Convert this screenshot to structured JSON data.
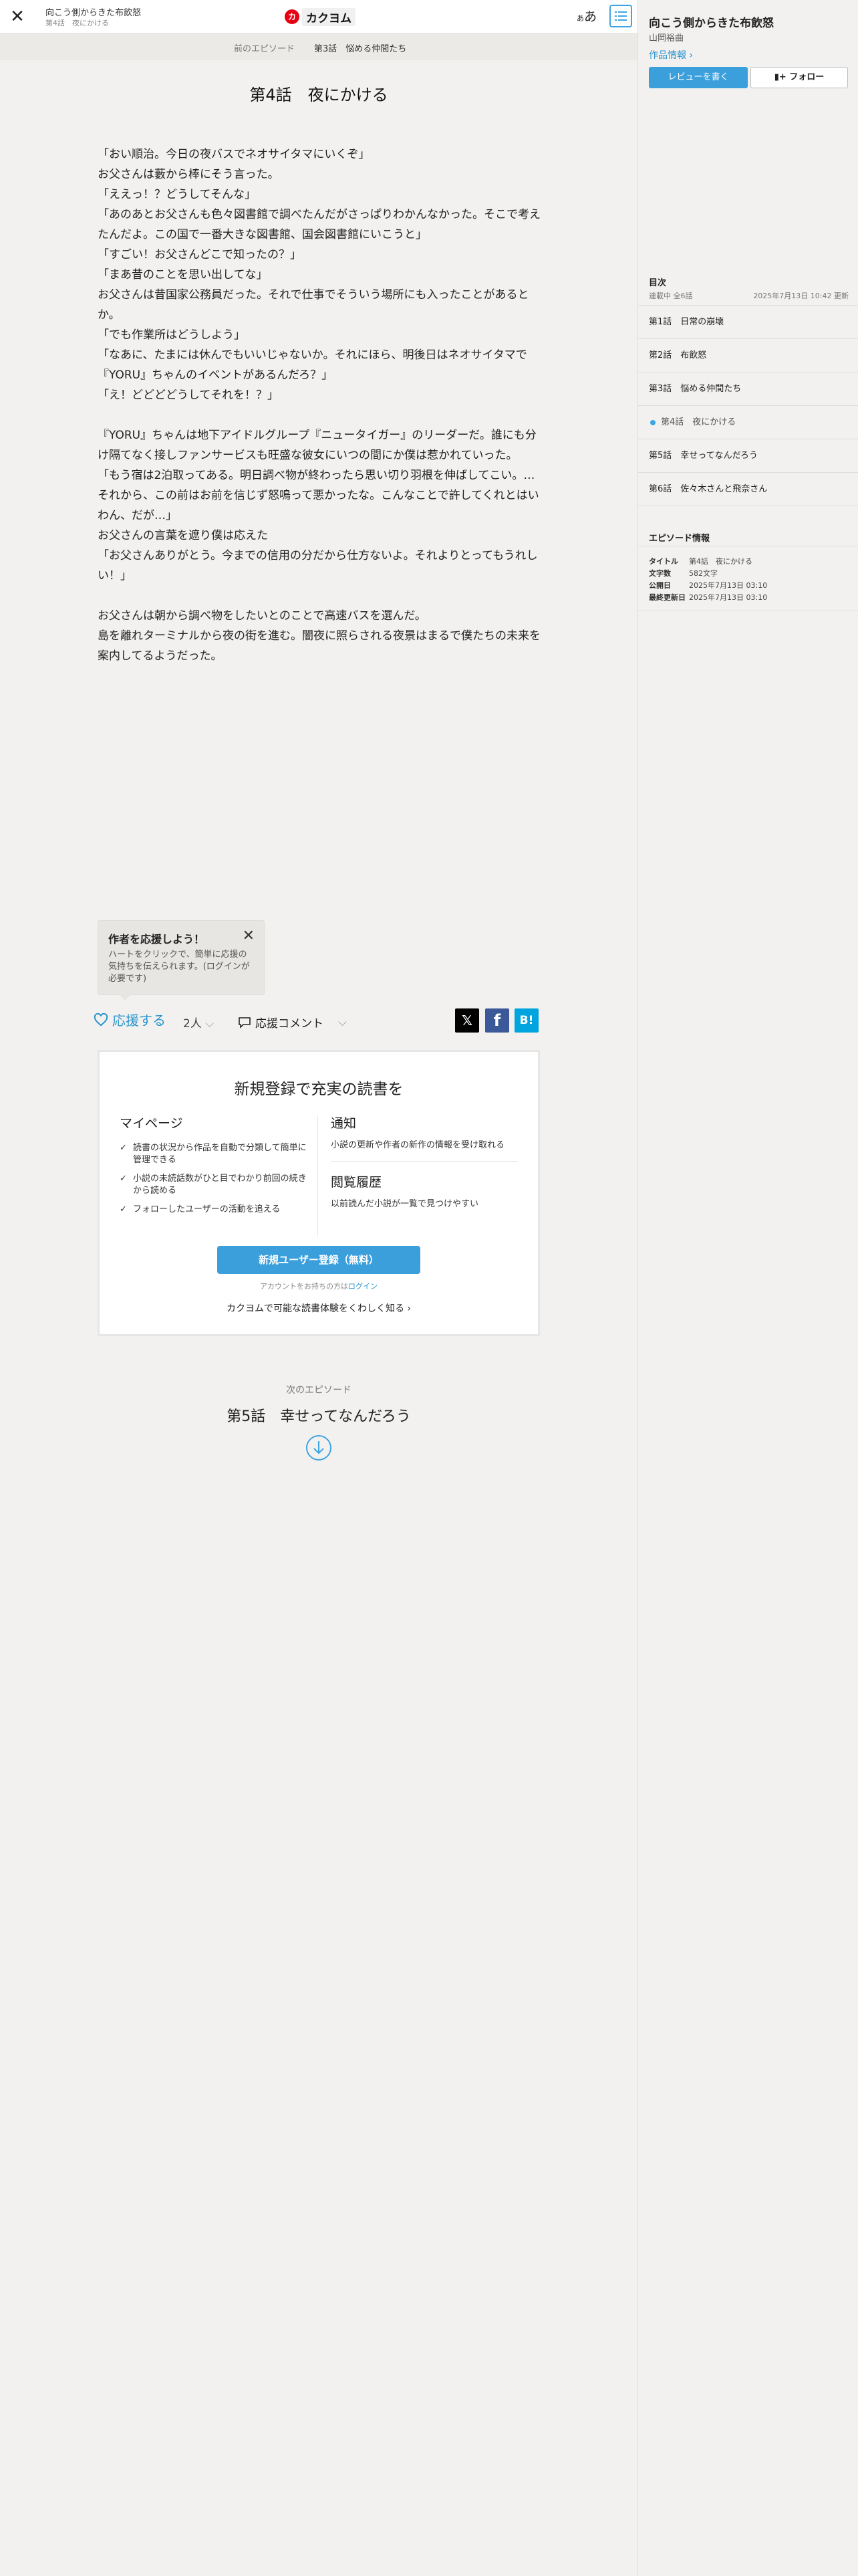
{
  "header": {
    "work_title": "向こう側からきた布飲怒",
    "episode_label": "第4話　夜にかける",
    "logo_mark": "カ",
    "logo_text": "カクヨム",
    "font_toggle_small": "あ",
    "font_toggle_large": "あ"
  },
  "episode_nav": {
    "prev_label": "前のエピソード",
    "prev_title": "第3話　悩める仲間たち"
  },
  "episode": {
    "title": "第4話　夜にかける",
    "body": [
      "「おい順治。今日の夜バスでネオサイタマにいくぞ」",
      "お父さんは藪から棒にそう言った。",
      "「ええっ！？どうしてそんな」",
      "「あのあとお父さんも色々図書館で調べたんだがさっぱりわかんなかった。そこで考えたんだよ。この国で一番大きな図書館、国会図書館にいこうと」",
      "「すごい！お父さんどこで知ったの？」",
      "「まあ昔のことを思い出してな」",
      "お父さんは昔国家公務員だった。それで仕事でそういう場所にも入ったことがあるとか。",
      "「でも作業所はどうしよう」",
      "「なあに、たまには休んでもいいじゃないか。それにほら、明後日はネオサイタマで『YORU』ちゃんのイベントがあるんだろ？」",
      "「え！どどどどうしてそれを！？」",
      "",
      "『YORU』ちゃんは地下アイドルグループ『ニュータイガー』のリーダーだ。誰にも分け隔てなく接しファンサービスも旺盛な彼女にいつの間にか僕は惹かれていった。",
      "「もう宿は2泊取ってある。明日調べ物が終わったら思い切り羽根を伸ばしてこい。…それから、この前はお前を信じず怒鳴って悪かったな。こんなことで許してくれとはいわん、だが…」",
      "お父さんの言葉を遮り僕は応えた",
      "「お父さんありがとう。今までの信用の分だから仕方ないよ。それよりとってもうれしい！」",
      "",
      "お父さんは朝から調べ物をしたいとのことで高速バスを選んだ。",
      "島を離れターミナルから夜の街を進む。闇夜に照らされる夜景はまるで僕たちの未来を案内してるようだった。"
    ]
  },
  "support_tip": {
    "title": "作者を応援しよう！",
    "text": "ハートをクリックで、簡単に応援の気持ちを伝えられます。(ログインが必要です)"
  },
  "support_row": {
    "heart_label": "応援する",
    "count": "2人",
    "comment_label": "応援コメント",
    "share_x": "𝕏",
    "share_fb": "f",
    "share_hb": "B!"
  },
  "signup": {
    "title": "新規登録で充実の読書を",
    "mypage_heading": "マイページ",
    "mypage_items": [
      "読書の状況から作品を自動で分類して簡単に管理できる",
      "小説の未読話数がひと目でわかり前回の続きから読める",
      "フォローしたユーザーの活動を追える"
    ],
    "notify_heading": "通知",
    "notify_text": "小説の更新や作者の新作の情報を受け取れる",
    "history_heading": "閲覧履歴",
    "history_text": "以前読んだ小説が一覧で見つけやすい",
    "button": "新規ユーザー登録（無料）",
    "login_prefix": "アカウントをお持ちの方は",
    "login_link": "ログイン",
    "learn_more": "カクヨムで可能な読書体験をくわしく知る"
  },
  "next_episode": {
    "label": "次のエピソード",
    "title": "第5話　幸せってなんだろう"
  },
  "sidebar": {
    "work_title": "向こう側からきた布飲怒",
    "author": "山岡裕曲",
    "work_info": "作品情報",
    "review_button": "レビューを書く",
    "follow_button": "フォロー",
    "toc_heading": "目次",
    "toc_status": "連載中 全6話",
    "toc_updated": "2025年7月13日 10:42 更新",
    "toc": [
      {
        "title": "第1話　日常の崩壊"
      },
      {
        "title": "第2話　布飲怒"
      },
      {
        "title": "第3話　悩める仲間たち"
      },
      {
        "title": "第4話　夜にかける"
      },
      {
        "title": "第5話　幸せってなんだろう"
      },
      {
        "title": "第6話　佐々木さんと飛奈さん"
      }
    ],
    "episode_info_heading": "エピソード情報",
    "episode_info": [
      {
        "key": "タイトル",
        "value": "第4話　夜にかける"
      },
      {
        "key": "文字数",
        "value": "582文字"
      },
      {
        "key": "公開日",
        "value": "2025年7月13日 03:10"
      },
      {
        "key": "最終更新日",
        "value": "2025年7月13日 03:10"
      }
    ]
  },
  "colors": {
    "accent": "#3b9fdc",
    "link": "#2a94cc",
    "logo_red": "#e60012"
  }
}
